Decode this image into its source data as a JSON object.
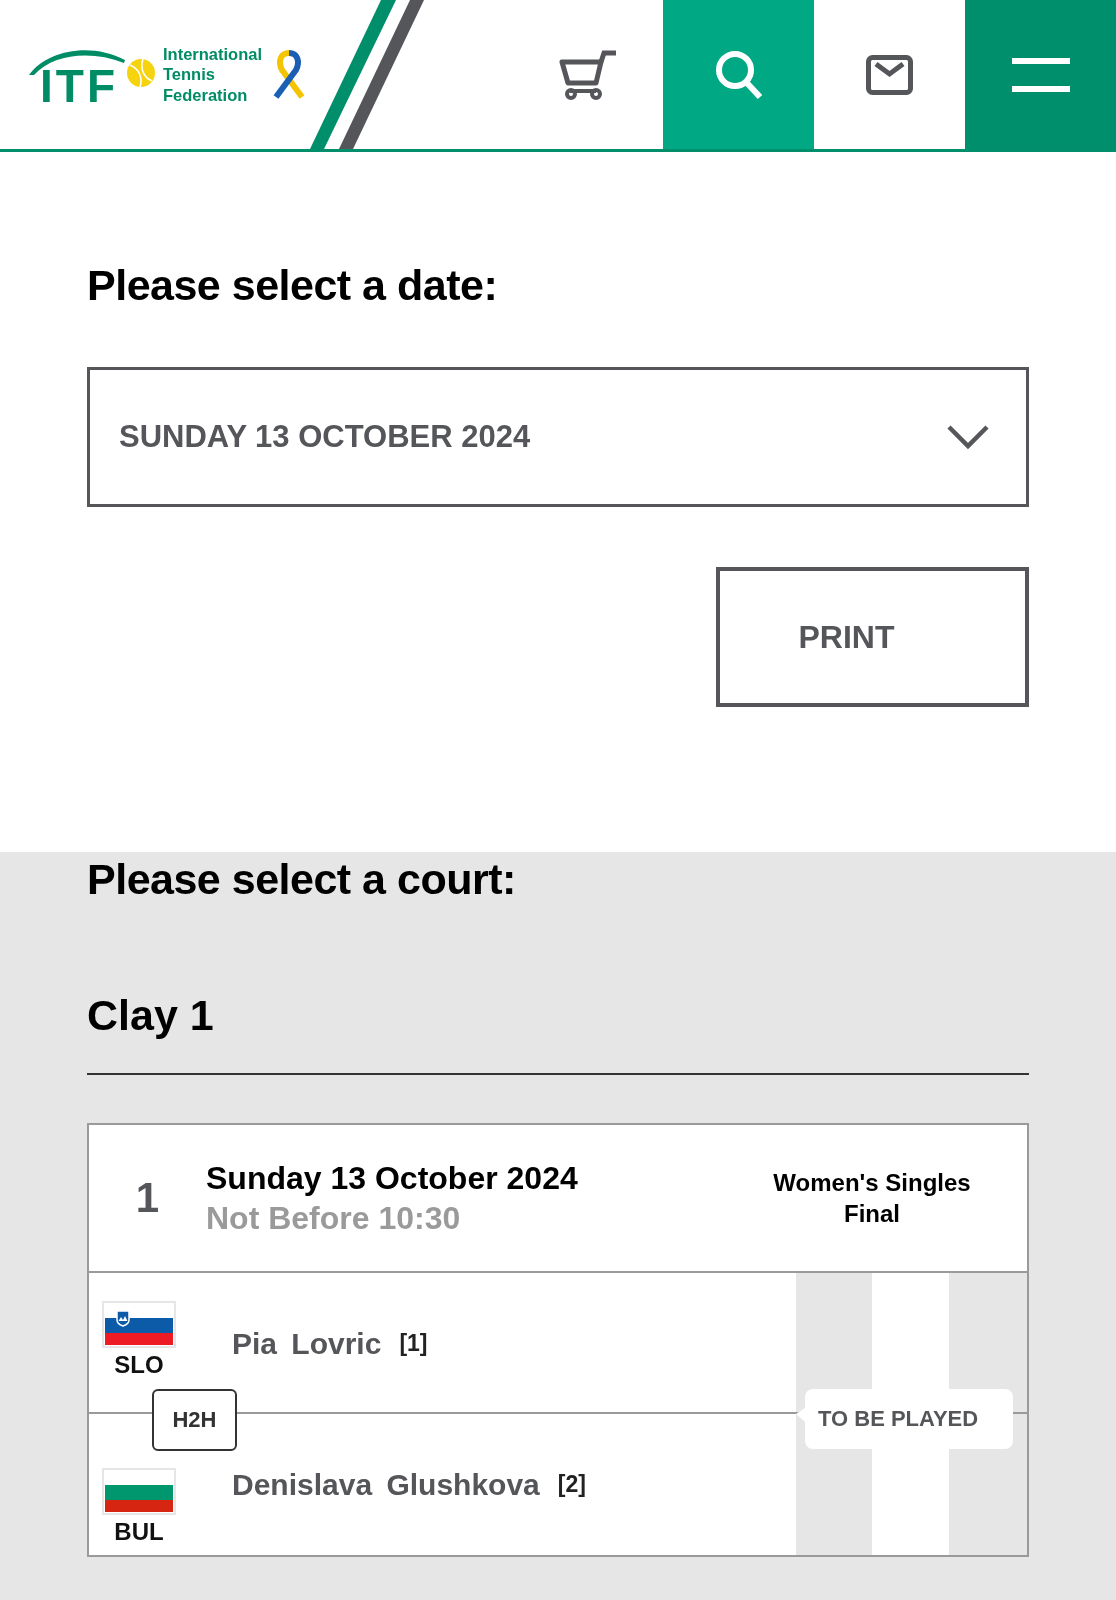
{
  "header": {
    "logo": {
      "mark": "ITF",
      "name": "International Tennis Federation"
    },
    "nav": [
      {
        "kind": "cart"
      },
      {
        "kind": "search"
      },
      {
        "kind": "mail"
      },
      {
        "kind": "menu"
      }
    ]
  },
  "date_section": {
    "heading": "Please select a date:",
    "date_select": {
      "value": "SUNDAY 13 OCTOBER 2024"
    },
    "print_button": "PRINT"
  },
  "court_section": {
    "heading": "Please select a court:",
    "courts": [
      {
        "name": "Clay 1",
        "matches": [
          {
            "order": "1",
            "date": "Sunday 13 October 2024",
            "time": "Not Before 10:30",
            "event": "Women's Singles Final",
            "players": [
              {
                "flag": {
                  "kind": "slovenia"
                },
                "country": "SLO",
                "name": "Pia Lovric",
                "seed": "[1]"
              },
              {
                "flag": {
                  "kind": "bulgaria"
                },
                "country": "BUL",
                "name": "Denislava Glushkova",
                "seed": "[2]"
              }
            ],
            "h2h": "H2H",
            "status": "TO BE PLAYED"
          }
        ]
      }
    ]
  }
}
